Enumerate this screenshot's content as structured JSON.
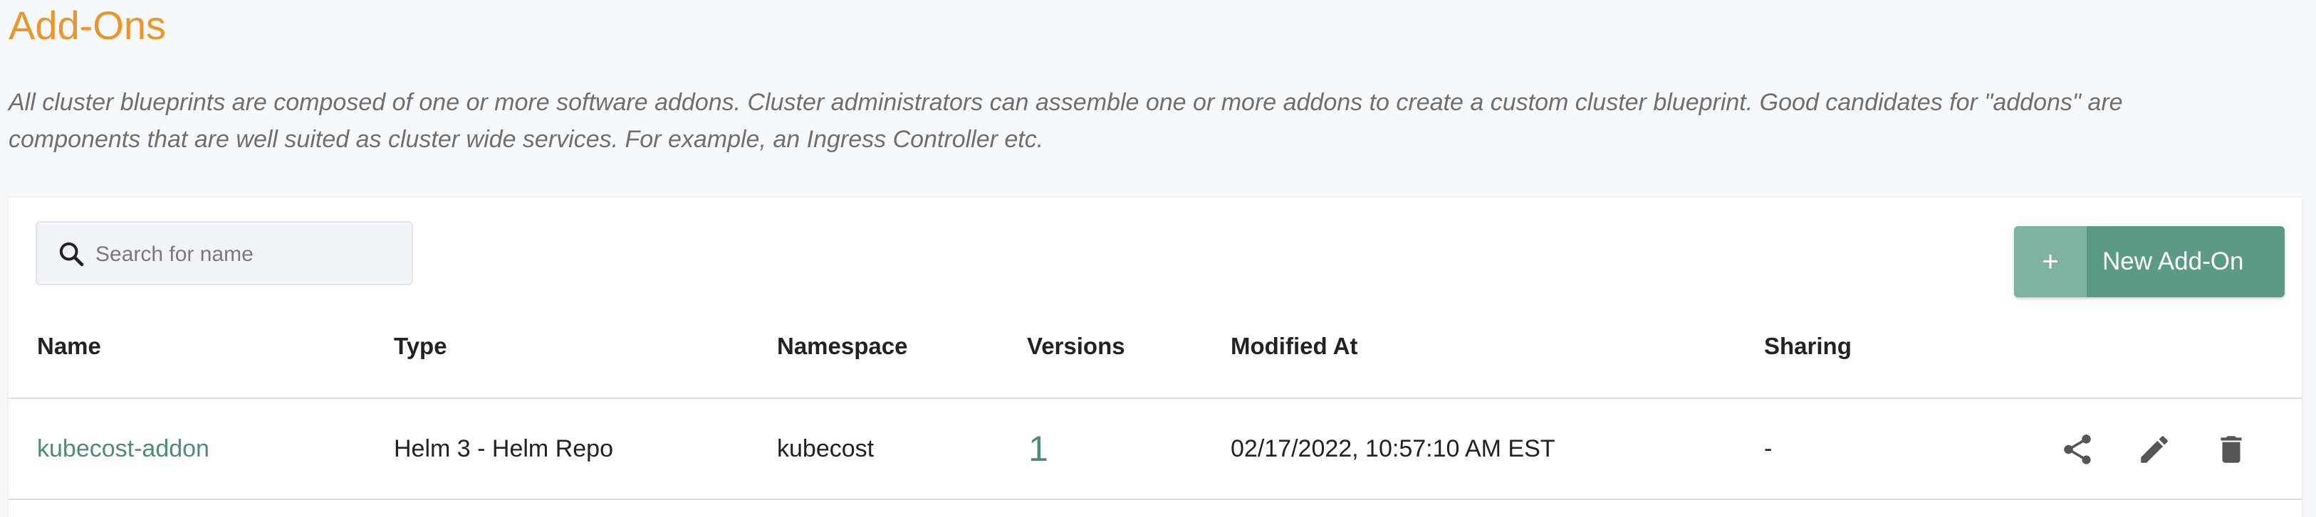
{
  "page": {
    "title": "Add-Ons",
    "description": "All cluster blueprints are composed of one or more software addons. Cluster administrators can assemble one or more addons to create a custom cluster blueprint. Good candidates for \"addons\" are components that are well suited as cluster wide services. For example, an Ingress Controller etc."
  },
  "search": {
    "placeholder": "Search for name",
    "value": "",
    "icon": "search-icon"
  },
  "toolbar": {
    "new_button_icon": "+",
    "new_button_label": "New Add-On"
  },
  "table": {
    "columns": [
      "Name",
      "Type",
      "Namespace",
      "Versions",
      "Modified At",
      "Sharing"
    ],
    "rows": [
      {
        "name": "kubecost-addon",
        "type": "Helm 3 - Helm Repo",
        "namespace": "kubecost",
        "versions": "1",
        "modified_at": "02/17/2022, 10:57:10 AM EST",
        "sharing": "-",
        "actions": [
          "share-icon",
          "edit-icon",
          "delete-icon"
        ]
      }
    ]
  },
  "colors": {
    "title": "#e8962e",
    "accent": "#5b9b86",
    "link": "#4f8b76"
  }
}
